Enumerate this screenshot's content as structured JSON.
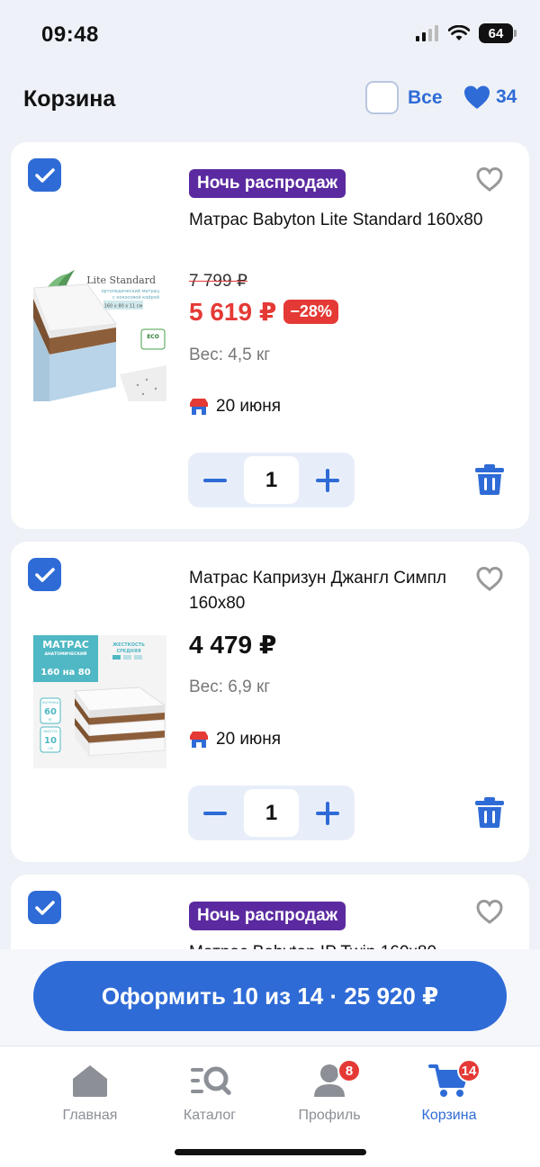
{
  "status": {
    "time": "09:48",
    "battery": "64"
  },
  "header": {
    "title": "Корзина",
    "select_all_label": "Все",
    "favorites_count": "34"
  },
  "items": [
    {
      "badge": "Ночь распродаж",
      "name": "Матрас Babyton Lite Standard 160x80",
      "old_price": "7 799 ₽",
      "price": "5 619 ₽",
      "discount": "−28%",
      "weight": "Вес: 4,5 кг",
      "delivery": "20 июня",
      "qty": "1",
      "image": {
        "brand": "Lite Standard",
        "line1": "ортопедический матрац",
        "line2": "с кокосовой койрой",
        "size": "160 х 80 х 11 см",
        "eco": "ECO"
      }
    },
    {
      "name": "Матрас Капризун Джангл Симпл 160x80",
      "price": "4 479 ₽",
      "weight": "Вес: 6,9 кг",
      "delivery": "20 июня",
      "qty": "1",
      "image": {
        "title": "МАТРАС",
        "subtitle": "АНАТОМИЧЕСКИЙ",
        "size": "160 на 80",
        "stiffness_label": "ЖЕСТКОСТЬ",
        "stiffness_value": "СРЕДНЯЯ",
        "load_label": "НАГРУЗКА",
        "load_value": "60",
        "load_unit": "КГ",
        "height_label": "ВЫСОТА",
        "height_value": "10",
        "height_unit": "СМ"
      }
    },
    {
      "badge": "Ночь распродаж",
      "name_partial": "Матрас Babyton IP Twin 160x80"
    }
  ],
  "checkout": {
    "label": "Оформить 10 из 14 · 25 920 ₽"
  },
  "tabs": [
    {
      "label": "Главная",
      "icon": "home-icon"
    },
    {
      "label": "Каталог",
      "icon": "catalog-search-icon"
    },
    {
      "label": "Профиль",
      "icon": "profile-icon",
      "badge": "8"
    },
    {
      "label": "Корзина",
      "icon": "cart-icon",
      "badge": "14",
      "active": true
    }
  ],
  "colors": {
    "accent": "#2f6bd6",
    "sale": "#e53935",
    "promo_badge": "#5b2aa0",
    "background": "#eef1f7"
  }
}
